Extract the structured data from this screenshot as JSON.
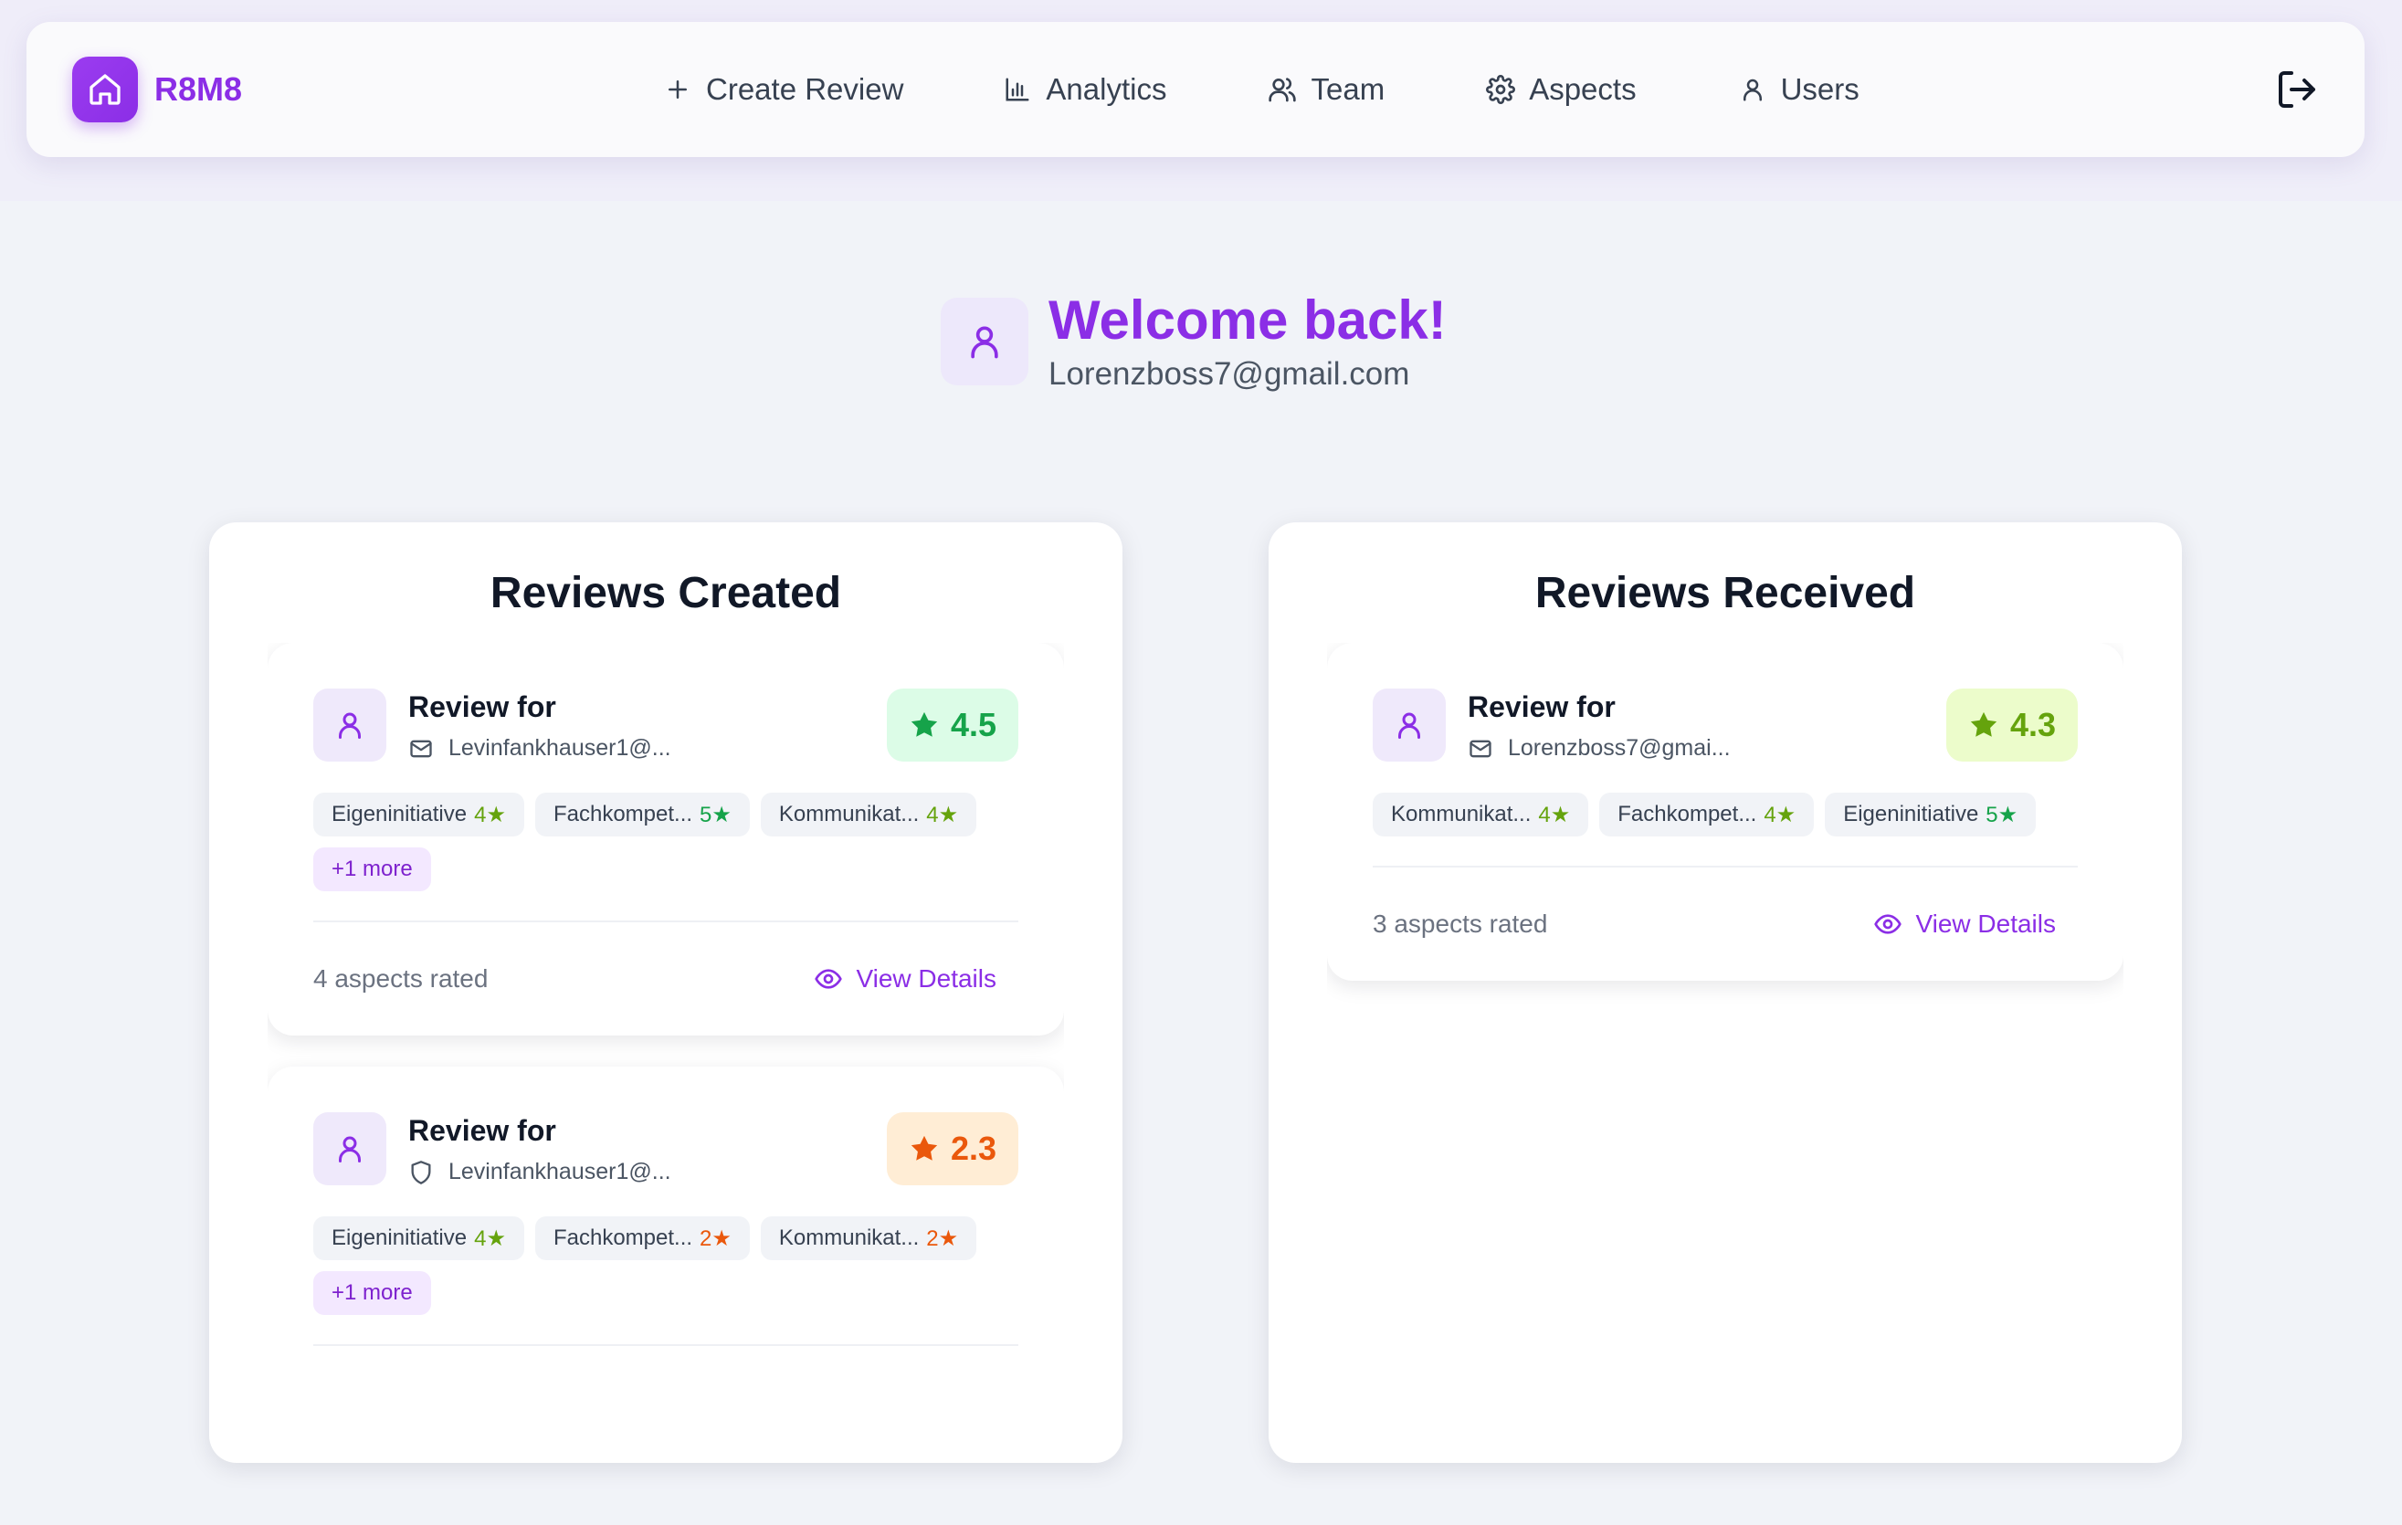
{
  "app": {
    "name": "R8M8"
  },
  "nav": {
    "items": [
      {
        "label": "Create Review",
        "icon": "plus-icon"
      },
      {
        "label": "Analytics",
        "icon": "bar-chart-icon"
      },
      {
        "label": "Team",
        "icon": "users-icon"
      },
      {
        "label": "Aspects",
        "icon": "gear-icon"
      },
      {
        "label": "Users",
        "icon": "user-icon"
      }
    ],
    "logout_icon": "logout-icon"
  },
  "welcome": {
    "title": "Welcome back!",
    "email": "Lorenzboss7@gmail.com"
  },
  "colors": {
    "brand": "#8b2ee6",
    "rating_high": "#16a34a",
    "rating_mid": "#65a30d",
    "rating_low": "#ea580c"
  },
  "reviews_created": {
    "title": "Reviews Created",
    "cards": [
      {
        "title": "Review for",
        "subject": "Levinfankhauser1@...",
        "subject_icon": "mail-icon",
        "rating": "4.5",
        "chips": [
          {
            "label": "Eigeninitiative",
            "value": "4★"
          },
          {
            "label": "Fachkompet...",
            "value": "5★"
          },
          {
            "label": "Kommunikat...",
            "value": "4★"
          }
        ],
        "more": "+1 more",
        "aspects": "4 aspects rated",
        "view": "View Details"
      },
      {
        "title": "Review for",
        "subject": "Levinfankhauser1@...",
        "subject_icon": "shield-icon",
        "rating": "2.3",
        "chips": [
          {
            "label": "Eigeninitiative",
            "value": "4★"
          },
          {
            "label": "Fachkompet...",
            "value": "2★"
          },
          {
            "label": "Kommunikat...",
            "value": "2★"
          }
        ],
        "more": "+1 more"
      }
    ]
  },
  "reviews_received": {
    "title": "Reviews Received",
    "cards": [
      {
        "title": "Review for",
        "subject": "Lorenzboss7@gmai...",
        "subject_icon": "mail-icon",
        "rating": "4.3",
        "chips": [
          {
            "label": "Kommunikat...",
            "value": "4★"
          },
          {
            "label": "Fachkompet...",
            "value": "4★"
          },
          {
            "label": "Eigeninitiative",
            "value": "5★"
          }
        ],
        "aspects": "3 aspects rated",
        "view": "View Details"
      }
    ]
  }
}
